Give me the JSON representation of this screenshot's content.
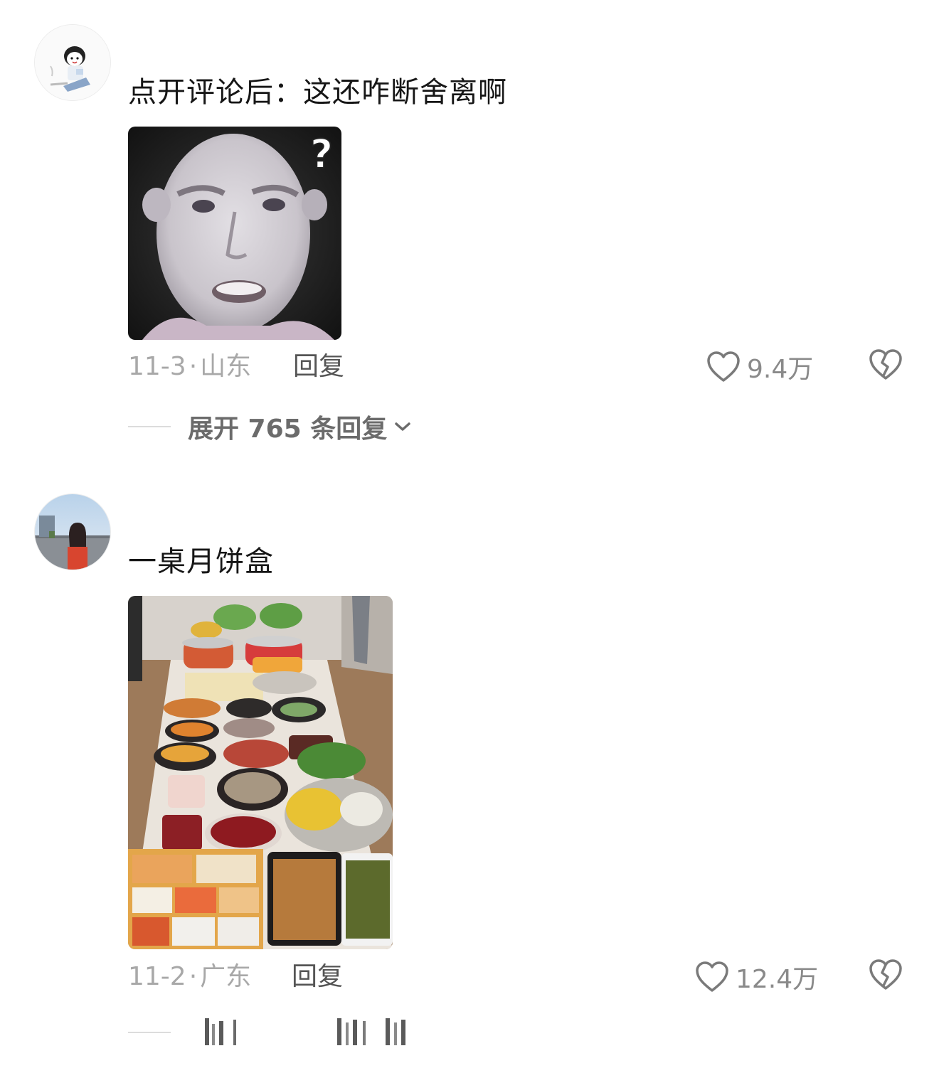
{
  "comments": [
    {
      "text": "点开评论后：这还咋断舍离啊",
      "date": "11-3",
      "separator": "·",
      "location": "山东",
      "reply_label": "回复",
      "likes": "9.4万",
      "expand_label": "展开 765 条回复"
    },
    {
      "text": "一桌月饼盒",
      "date": "11-2",
      "separator": "·",
      "location": "广东",
      "reply_label": "回复",
      "likes": "12.4万"
    }
  ],
  "icons": {
    "like": "heart-outline-icon",
    "dislike": "broken-heart-icon",
    "expand": "chevron-down-icon"
  },
  "colors": {
    "text": "#161616",
    "meta": "#a8a8a8",
    "reply": "#555555",
    "expand": "#6b6b6b"
  }
}
